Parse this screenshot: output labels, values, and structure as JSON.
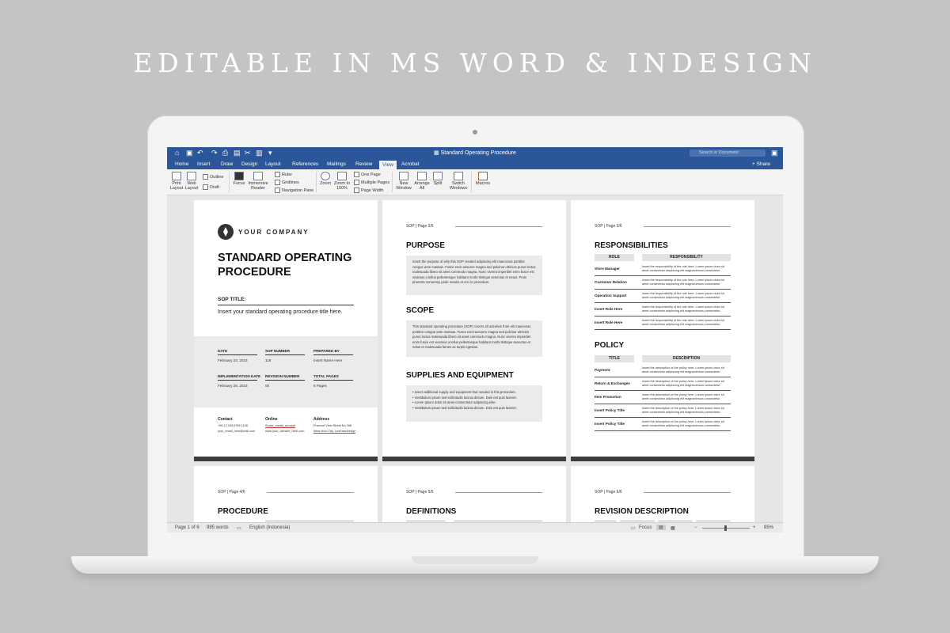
{
  "headline": "EDITABLE IN MS WORD & INDESIGN",
  "window": {
    "document_title": "Standard Operating Procedure",
    "search_placeholder": "Search in Document",
    "share_label": "Share"
  },
  "tabs": [
    "Home",
    "Insert",
    "Draw",
    "Design",
    "Layout",
    "References",
    "Mailings",
    "Review",
    "View",
    "Acrobat"
  ],
  "active_tab": "View",
  "ribbon": {
    "print_layout": "Print Layout",
    "web_layout": "Web Layout",
    "outline": "Outline",
    "draft": "Draft",
    "focus": "Focus",
    "immersive_reader": "Immersive Reader",
    "ruler": "Ruler",
    "gridlines": "Gridlines",
    "navigation_pane": "Navigation Pane",
    "zoom": "Zoom",
    "zoom_100": "Zoom to 100%",
    "one_page": "One Page",
    "multiple_pages": "Multiple Pages",
    "page_width": "Page Width",
    "new_window": "New Window",
    "arrange_all": "Arrange All",
    "split": "Split",
    "switch_windows": "Switch Windows",
    "macros": "Macros"
  },
  "cover": {
    "company": "YOUR COMPANY",
    "title": "STANDARD OPERATING PROCEDURE",
    "sop_title_label": "SOP TITLE:",
    "sop_title_value": "Insert your standard operating procedure title here.",
    "date_label": "DATE",
    "date_value": "February 23, 2023",
    "sop_number_label": "SOP NUMBER",
    "sop_number_value": "118",
    "prepared_by_label": "PREPARED BY",
    "prepared_by_value": "Insert Name Here",
    "impl_label": "IMPLEMENTATION DATE",
    "impl_value": "February 28, 2023",
    "revision_label": "REVISION NUMBER",
    "revision_value": "00",
    "total_pages_label": "TOTAL PAGES",
    "total_pages_value": "6 Pages",
    "contact_label": "Contact",
    "contact_phone": "+85 12 345 6789 1108",
    "contact_email": "your_email_here@mail.com",
    "online_label": "Online",
    "online_social": "Social_media_account",
    "online_site": "www.your_website_here.com",
    "address_label": "Address",
    "address_line1": "Pramont View Street No 188",
    "address_line2": "West Nulo City, LeoFaseDesign"
  },
  "page2": {
    "page_num": "SOP | Page 2/6",
    "purpose": "PURPOSE",
    "purpose_text": "Insert the purpose of why this SOP created adipiscing elit maecenas porttitor congue ante massae. Fusce escit aesuere magna sed pulvinar ultricies purus lectus malesuada libero sit amet commodo magna. Nunc viverra imperdiet enim fusce est vivamus a tellus pellentesque habitant morbi tristique senectus et netus. Proin pharetra nonummy pede mauris et orci in procedure.",
    "scope": "SCOPE",
    "scope_text": "This standard operating procedure (SOP) covers all activities from elit maecenas porttitor congue ante massae. Fusce escit aesuere magna sed pulvinar ultricies purus lectus malesuada libero sit amet commodo magna. Nunc viverra imperdiet enim fusce est vivamus a tellus pellentesque habitant morbi tristique senectus et netus et malesuada fames ac turpis egestas.",
    "supplies": "SUPPLIES AND EQUIPMENT",
    "supplies_items": [
      "Insert additional supply and equipment that needed in this procedure.",
      "Vestibulum ipsum sed sollicitudin lacinia dictum. Duis est quis laoreet.",
      "Lorem ipsum dolor sit amet consectetur adipiscing elite.",
      "Vestibulum ipsum sed sollicitudin lacinia dictum. Duis est quis laoreet."
    ]
  },
  "page3": {
    "page_num": "SOP | Page 3/6",
    "responsibilities": "RESPONSIBILITIES",
    "col_role": "ROLE",
    "col_responsibility": "RESPONSIBILITY",
    "roles": [
      {
        "name": "Store Manager",
        "text": "Insert the responsibility of the role here. Lorem ipsum dolor sit amet consectetur adipiscing elit magnanimous consectetur."
      },
      {
        "name": "Customer Relation",
        "text": "Insert the responsibility of the role here. Lorem ipsum dolor sit amet consectetur adipiscing elit magnanimous consectetur."
      },
      {
        "name": "Operation Support",
        "text": "Insert the responsibility of the role here. Lorem ipsum dolor sit amet consectetur adipiscing elit magnanimous consectetur."
      },
      {
        "name": "Insert Role Here",
        "text": "Insert the responsibility of the role here. Lorem ipsum dolor sit amet consectetur adipiscing elit magnanimous consectetur."
      },
      {
        "name": "Insert Role Here",
        "text": "Insert the responsibility of the role here. Lorem ipsum dolor sit amet consectetur adipiscing elit magnanimous consectetur."
      }
    ],
    "policy": "POLICY",
    "col_title": "TITLE",
    "col_description": "DESCRIPTION",
    "policies": [
      {
        "name": "Payment",
        "text": "Insert the description of the policy here. Lorem ipsum dolor sit amet consectetur adipiscing elit magnanimous consectetur."
      },
      {
        "name": "Return & Exchanges",
        "text": "Insert the description of the policy here. Lorem ipsum dolor sit amet consectetur adipiscing elit magnanimous consectetur."
      },
      {
        "name": "Item Promotion",
        "text": "Insert the description of the policy here. Lorem ipsum dolor sit amet consectetur adipiscing elit magnanimous consectetur."
      },
      {
        "name": "Insert Policy Title",
        "text": "Insert the description of the policy here. Lorem ipsum dolor sit amet consectetur adipiscing elit magnanimous consectetur."
      },
      {
        "name": "Insert Policy Title",
        "text": "Insert the description of the policy here. Lorem ipsum dolor sit amet consectetur adipiscing elit magnanimous consectetur."
      }
    ]
  },
  "page4": {
    "page_num": "SOP | Page 4/6",
    "heading": "PROCEDURE"
  },
  "page5": {
    "page_num": "SOP | Page 5/6",
    "heading": "DEFINITIONS"
  },
  "page6": {
    "page_num": "SOP | Page 6/6",
    "heading": "REVISION DESCRIPTION"
  },
  "status": {
    "page": "Page 1 of 6",
    "words": "985 words",
    "language": "English (Indonesia)",
    "focus": "Focus",
    "zoom": "85%"
  }
}
